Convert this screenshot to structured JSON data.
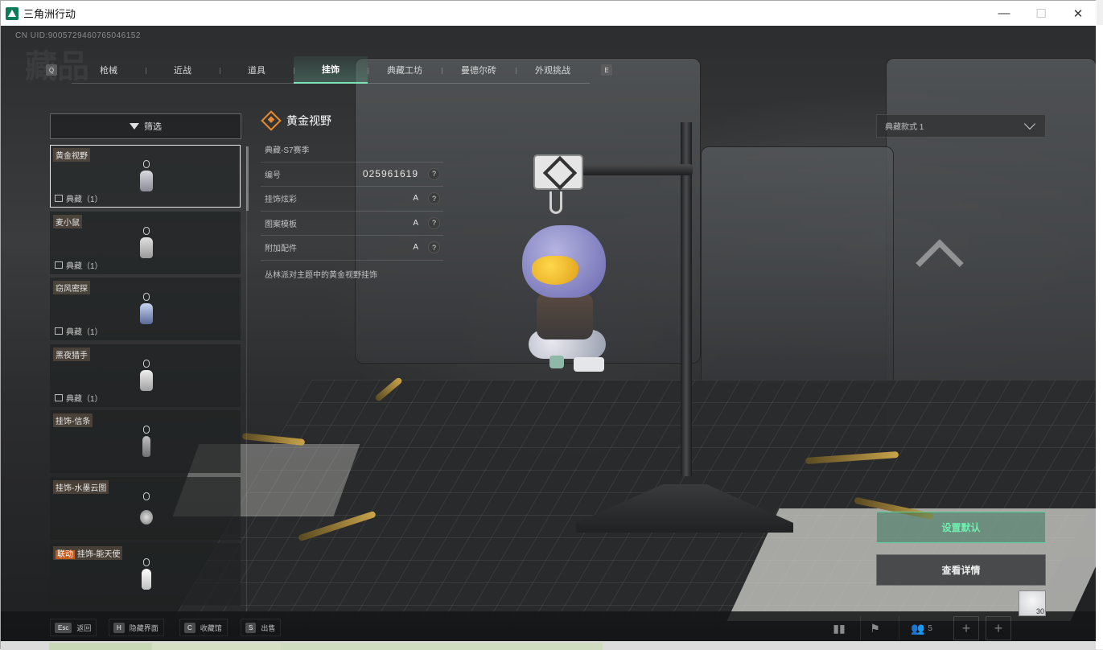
{
  "window": {
    "title": "三角洲行动",
    "controls": {
      "minimize": "—",
      "maximize": "☐",
      "close": "✕"
    }
  },
  "game": {
    "uid": "CN UID:9005729460765046152",
    "bg_title": "藏品",
    "tabs": {
      "left_key": "Q",
      "right_key": "E",
      "items": [
        "枪械",
        "近战",
        "道具",
        "挂饰",
        "典藏工坊",
        "曼德尔砖",
        "外观挑战"
      ],
      "active": "挂饰"
    },
    "filter": {
      "label": "筛选"
    },
    "list": [
      {
        "tag": "",
        "name": "黄金视野",
        "sub": "典藏（1）",
        "selected": true
      },
      {
        "tag": "",
        "name": "麦小鼠",
        "sub": "典藏（1）",
        "selected": false
      },
      {
        "tag": "",
        "name": "窃风密探",
        "sub": "典藏（1）",
        "selected": false
      },
      {
        "tag": "",
        "name": "黑夜猎手",
        "sub": "典藏（1）",
        "selected": false
      },
      {
        "tag": "",
        "name": "挂饰-信条",
        "sub": "",
        "selected": false
      },
      {
        "tag": "",
        "name": "挂饰-水墨云图",
        "sub": "",
        "selected": false
      },
      {
        "tag": "联动",
        "name": "挂饰-能天使",
        "sub": "",
        "selected": false
      }
    ],
    "detail": {
      "title": "黄金视野",
      "season": "典藏-S7赛季",
      "rows": [
        {
          "label": "编号",
          "value": "025961619",
          "help": "?"
        },
        {
          "label": "挂饰炫彩",
          "value": "A",
          "help": "?"
        },
        {
          "label": "图案模板",
          "value": "A",
          "help": "?"
        },
        {
          "label": "附加配件",
          "value": "A",
          "help": "?"
        }
      ],
      "description": "丛林派对主题中的黄金视野挂饰"
    },
    "variant_select": {
      "value": "典藏款式 1"
    },
    "buttons": {
      "set_default": "设置默认",
      "view_details": "查看详情"
    },
    "bottom_hints": [
      {
        "key": "Esc",
        "label": "返回"
      },
      {
        "key": "H",
        "label": "隐藏界面"
      },
      {
        "key": "C",
        "label": "收藏馆"
      },
      {
        "key": "S",
        "label": "出售"
      }
    ],
    "bottom_right": {
      "party_count": "5",
      "avatar_level": "30"
    },
    "colors": {
      "accent_green": "#58d09a",
      "accent_orange": "#e98a2a",
      "tag_orange": "#c85a1e"
    },
    "icons": [
      "stats-icon",
      "flag-icon",
      "friends-icon",
      "plus-icon"
    ]
  }
}
